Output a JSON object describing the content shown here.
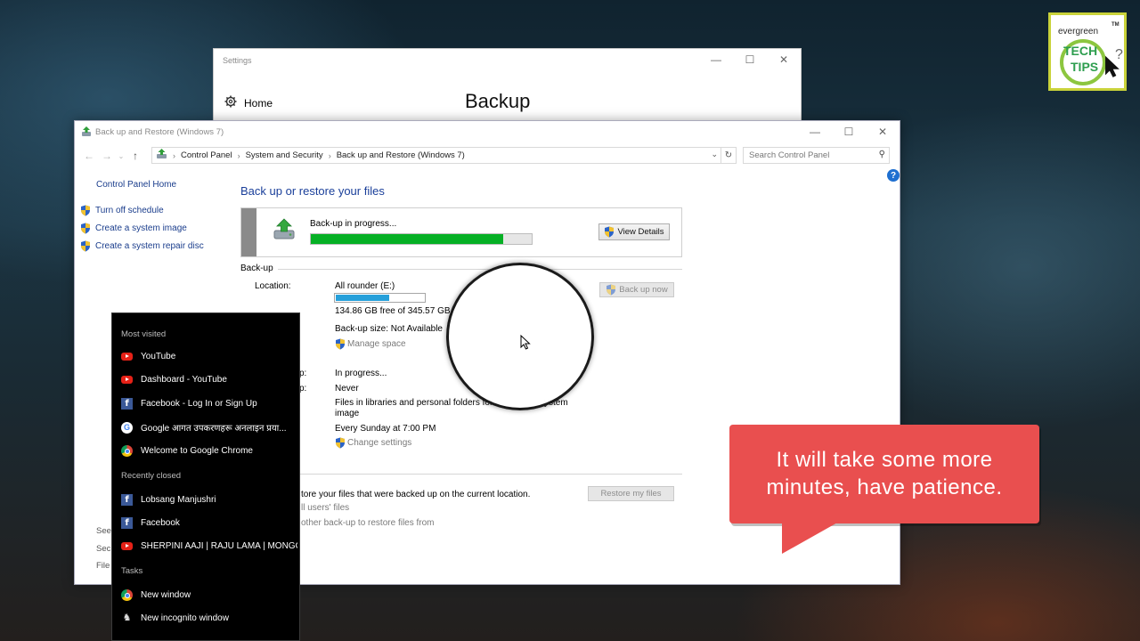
{
  "settings_window": {
    "title": "Settings",
    "home_label": "Home",
    "heading": "Backup"
  },
  "cp_window": {
    "title": "Back up and Restore (Windows 7)",
    "breadcrumb": [
      "Control Panel",
      "System and Security",
      "Back up and Restore (Windows 7)"
    ],
    "search_placeholder": "Search Control Panel",
    "sidebar": {
      "home": "Control Panel Home",
      "items": [
        "Turn off schedule",
        "Create a system image",
        "Create a system repair disc"
      ],
      "see_also_partial": [
        "See",
        "Secu",
        "File"
      ]
    },
    "main": {
      "title": "Back up or restore your files",
      "progress_label": "Back-up in progress...",
      "progress_fraction": 0.87,
      "view_details": "View Details",
      "section_backup": "Back-up",
      "location_label": "Location:",
      "location_value": "All rounder (E:)",
      "disk_used_fraction": 0.61,
      "disk_free": "134.86 GB free of 345.57 GB",
      "backup_size": "Back-up size: Not Available",
      "manage_space": "Manage space",
      "backup_now": "Back up now",
      "partial_label_1": "p:",
      "partial_label_2": "p:",
      "next_status": "In progress...",
      "last_status": "Never",
      "contents_text": "Files in libraries and personal folders for",
      "contents_text_end": "ystem",
      "contents_text_line2": "image",
      "schedule": "Every Sunday at 7:00 PM",
      "change_settings": "Change settings",
      "restore_text": "tore your files that were backed up on the current location.",
      "restore_all_users": "ll users' files",
      "restore_other": "other back-up to restore files from",
      "restore_button": "Restore my files"
    }
  },
  "jump_list": {
    "most_visited_header": "Most visited",
    "most_visited": [
      {
        "label": "YouTube",
        "icon": "youtube-icon"
      },
      {
        "label": "Dashboard - YouTube",
        "icon": "youtube-icon"
      },
      {
        "label": "Facebook - Log In or Sign Up",
        "icon": "facebook-icon"
      },
      {
        "label": "Google आगत उपकरणहरू अनलाइन प्रया...",
        "icon": "google-icon"
      },
      {
        "label": "Welcome to Google Chrome",
        "icon": "chrome-icon"
      }
    ],
    "recently_closed_header": "Recently closed",
    "recently_closed": [
      {
        "label": "Lobsang Manjushri",
        "icon": "facebook-icon"
      },
      {
        "label": "Facebook",
        "icon": "facebook-icon"
      },
      {
        "label": "SHERPINI AAJI | RAJU LAMA | MONGO...",
        "icon": "youtube-icon"
      }
    ],
    "tasks_header": "Tasks",
    "tasks": [
      {
        "label": "New window",
        "icon": "chrome-icon"
      },
      {
        "label": "New incognito window",
        "icon": "incognito-icon"
      }
    ]
  },
  "callout": {
    "line1": "It will take some more",
    "line2": "minutes, have patience."
  },
  "logo": {
    "top_text": "evergreen",
    "tm": "TM",
    "line1": "TECH",
    "line2": "TIPS",
    "mark": "?"
  },
  "colors": {
    "progress_green": "#06b025",
    "disk_blue": "#26a0da",
    "callout_red": "#e94f4f",
    "link_blue": "#1a3d8c"
  }
}
